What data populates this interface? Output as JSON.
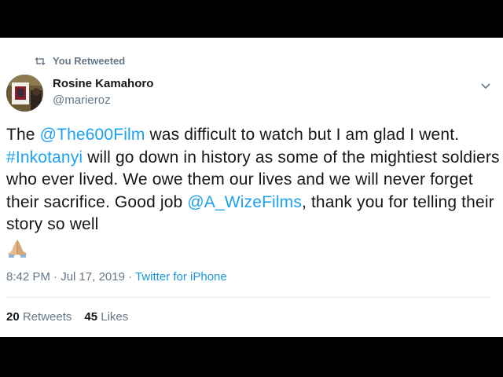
{
  "retweet": {
    "icon": "retweet-icon",
    "label": "You Retweeted"
  },
  "author": {
    "name": "Rosine Kamahoro",
    "handle": "@marieroz",
    "avatar_icon": "avatar-photo"
  },
  "menu_icon": "chevron-down-icon",
  "tweet": {
    "s1": "The ",
    "mention1": "@The600Film",
    "s2": " was difficult to watch but I am glad I went. ",
    "hashtag": "#Inkotanyi",
    "s3": " will go down in history as some of the mightiest soldiers who ever lived. We owe them our lives and we will never forget their sacrifice. Good job ",
    "mention2": "@A_WizeFilms",
    "s4": ", thank you for telling their story so well",
    "emoji": "folded-hands-emoji"
  },
  "meta": {
    "time": "8:42 PM",
    "sep1": " · ",
    "date": "Jul 17, 2019",
    "sep2": " · ",
    "source": "Twitter for iPhone"
  },
  "stats": {
    "retweets_count": "20",
    "retweets_label": "Retweets",
    "likes_count": "45",
    "likes_label": "Likes"
  },
  "colors": {
    "link": "#1da1f2",
    "secondary_text": "#657786",
    "primary_text": "#14171a",
    "letterbox": "#000000"
  }
}
